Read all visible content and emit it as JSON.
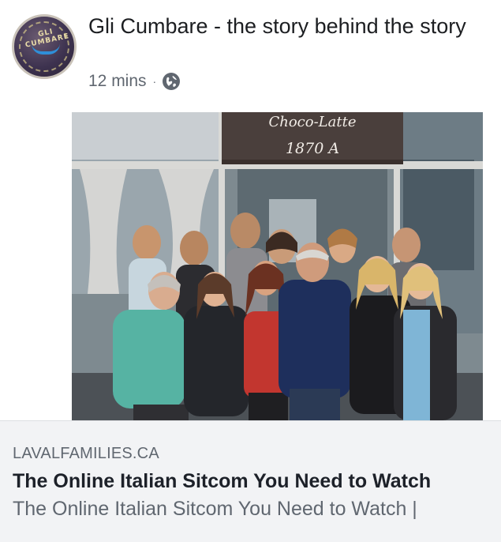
{
  "post": {
    "page_name": "Gli Cumbare - the story behind the story",
    "timestamp": "12 mins",
    "separator": "·",
    "privacy_icon": "globe-icon",
    "avatar_text": "GLI CUMBARE"
  },
  "photo": {
    "awning_top": "Choco-Latte",
    "awning_number": "1870 A"
  },
  "link_preview": {
    "domain": "LAVALFAMILIES.CA",
    "title": "The Online Italian Sitcom You Need to Watch",
    "description": "The Online Italian Sitcom You Need to Watch |"
  },
  "colors": {
    "secondary_text": "#606770",
    "card_background": "#f2f3f5",
    "title_text": "#1d2129"
  }
}
